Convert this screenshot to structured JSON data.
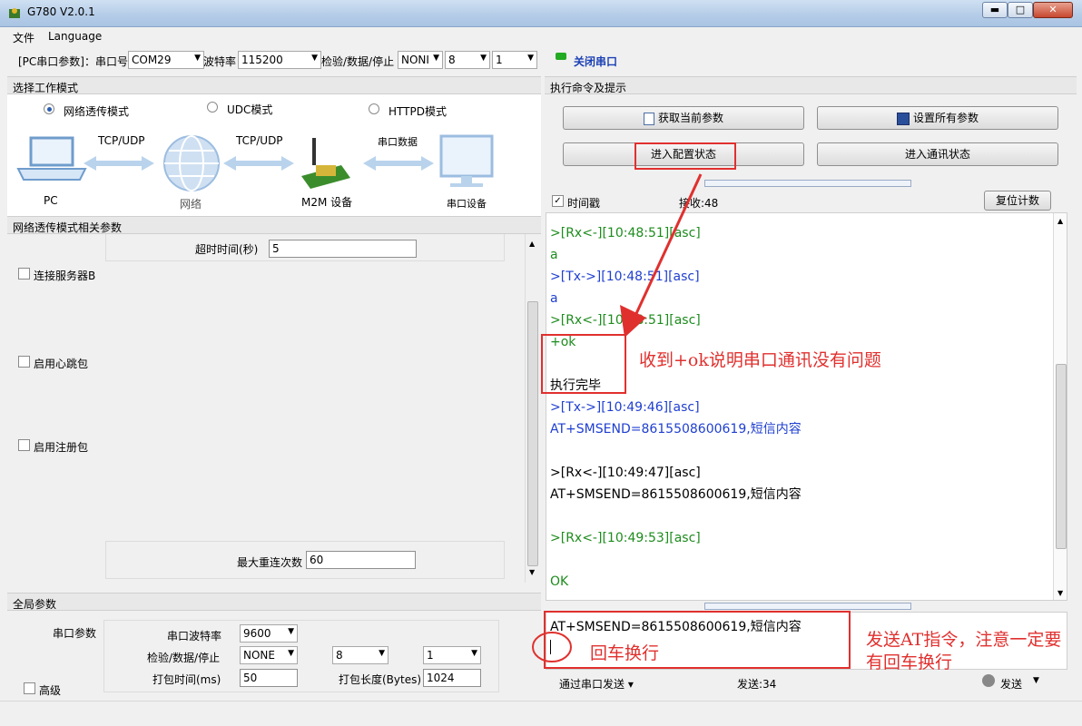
{
  "window": {
    "title": "G780 V2.0.1",
    "min": "▬",
    "max": "□",
    "close": "✕"
  },
  "menu": {
    "file": "文件",
    "language": "Language"
  },
  "serial_bar": {
    "label_prefix": "[PC串口参数]：串口号",
    "port": "COM29",
    "baud_label": "波特率",
    "baud": "115200",
    "parity_label": "检验/数据/停止",
    "parity": "NONI",
    "data_bits": "8",
    "stop_bits": "1",
    "close_port": "关闭串口",
    "status_color": "#22aa22"
  },
  "work_mode": {
    "title": "选择工作模式",
    "modes": [
      "网络透传模式",
      "UDC模式",
      "HTTPD模式"
    ],
    "selected": 0,
    "diagram": {
      "pc": "PC",
      "link1": "TCP/UDP",
      "network": "网络",
      "link2": "TCP/UDP",
      "m2m": "M2M 设备",
      "link3": "串口数据",
      "serial_dev": "串口设备"
    }
  },
  "net_params": {
    "title": "网络透传模式相关参数",
    "timeout_label": "超时时间(秒)",
    "timeout": "5",
    "server_b": "连接服务器B",
    "heartbeat": "启用心跳包",
    "register": "启用注册包",
    "max_reconnect_label": "最大重连次数",
    "max_reconnect": "60"
  },
  "global": {
    "title": "全局参数",
    "serial_params": "串口参数",
    "baud_label": "串口波特率",
    "baud": "9600",
    "parity_label": "检验/数据/停止",
    "parity": "NONE",
    "data_bits": "8",
    "stop_bits": "1",
    "pack_time_label": "打包时间(ms)",
    "pack_time": "50",
    "pack_len_label": "打包长度(Bytes)",
    "pack_len": "1024",
    "advanced": "高级"
  },
  "commands": {
    "title": "执行命令及提示",
    "get_params": "获取当前参数",
    "set_params": "设置所有参数",
    "enter_config": "进入配置状态",
    "enter_comm": "进入通讯状态"
  },
  "log": {
    "timestamp_label": "时间戳",
    "recv_label": "接收:48",
    "reset_label": "复位计数",
    "lines": [
      {
        "t": ">[Rx<-][10:48:51][asc]",
        "c": "rx"
      },
      {
        "t": "a",
        "c": "rx"
      },
      {
        "t": ">[Tx->][10:48:51][asc]",
        "c": "tx"
      },
      {
        "t": "a",
        "c": "tx"
      },
      {
        "t": ">[Rx<-][10:48:51][asc]",
        "c": "rx"
      },
      {
        "t": "+ok",
        "c": "rx"
      },
      {
        "t": "",
        "c": "rx"
      },
      {
        "t": "执行完毕",
        "c": "plain"
      },
      {
        "t": ">[Tx->][10:49:46][asc]",
        "c": "tx"
      },
      {
        "t": "AT+SMSEND=8615508600619,短信内容",
        "c": "tx"
      },
      {
        "t": "",
        "c": "tx"
      },
      {
        "t": ">[Rx<-][10:49:47][asc]",
        "c": "plain"
      },
      {
        "t": "AT+SMSEND=8615508600619,短信内容",
        "c": "plain"
      },
      {
        "t": "",
        "c": "plain"
      },
      {
        "t": ">[Rx<-][10:49:53][asc]",
        "c": "rx"
      },
      {
        "t": "",
        "c": "rx"
      },
      {
        "t": "OK",
        "c": "rx"
      }
    ]
  },
  "send": {
    "text": "AT+SMSEND=8615508600619,短信内容",
    "via": "通过串口发送",
    "count": "发送:34",
    "send_btn": "发送"
  },
  "annotations": {
    "ok_note": "收到+ok说明串口通讯没有问题",
    "newline_note": "回车换行",
    "at_note_1": "发送AT指令，注意一定要",
    "at_note_2": "有回车换行"
  }
}
